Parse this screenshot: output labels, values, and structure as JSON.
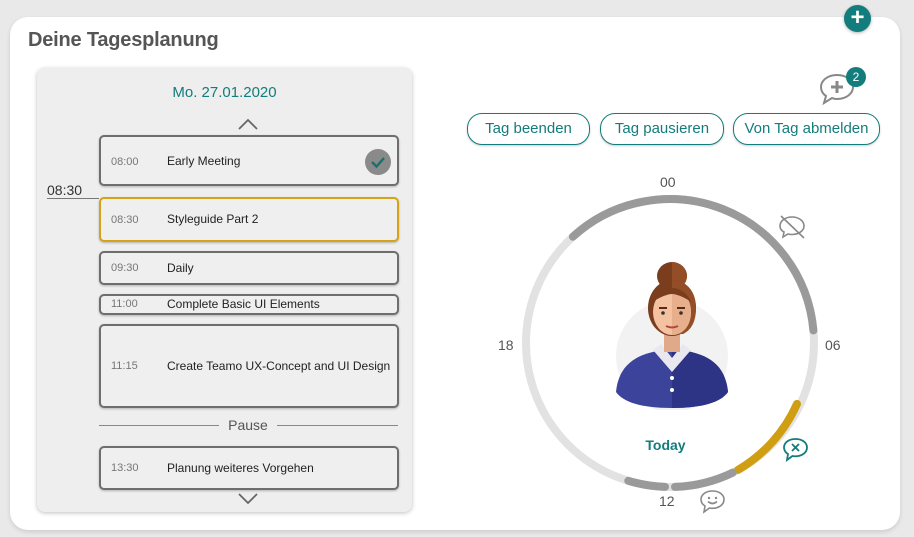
{
  "header": {
    "title": "Deine Tagesplanung",
    "add_icon": "plus-circle-icon"
  },
  "schedule": {
    "date": "Mo. 27.01.2020",
    "current_time": "08:30",
    "items": [
      {
        "time": "08:00",
        "name": "Early Meeting",
        "done": true
      },
      {
        "time": "08:30",
        "name": "Styleguide Part 2",
        "active": true
      },
      {
        "time": "09:30",
        "name": "Daily"
      },
      {
        "time": "11:00",
        "name": "Complete Basic UI Elements"
      },
      {
        "time": "11:15",
        "name": "Create Teamo UX-Concept and UI Design"
      },
      {
        "time": "13:30",
        "name": "Planung weiteres Vorgehen"
      }
    ],
    "pause_label": "Pause"
  },
  "actions": {
    "end_day": "Tag beenden",
    "pause_day": "Tag pausieren",
    "sign_off": "Von Tag abmelden"
  },
  "comments": {
    "count": "2",
    "icon": "add-comment-icon"
  },
  "clock": {
    "labels": {
      "top": "00",
      "right": "06",
      "bottom": "12",
      "left": "18"
    },
    "center_label": "Today",
    "colors": {
      "track": "#e1e1e1",
      "logged": "#9a9a9a",
      "active": "#d09e12",
      "accent": "#137c7c"
    },
    "icons": [
      "no-comment-icon",
      "cancel-comment-icon",
      "smiley-icon"
    ]
  }
}
